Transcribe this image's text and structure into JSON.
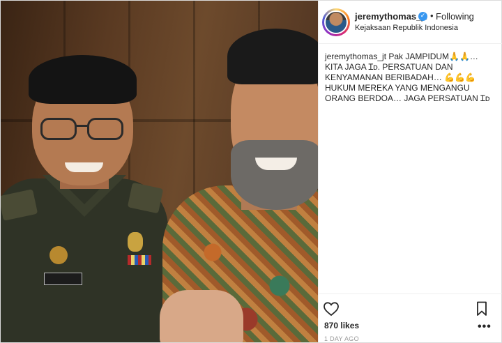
{
  "post": {
    "username": "jeremythomas_jt",
    "verified_icon": "verified-badge-icon",
    "separator": "•",
    "follow_status": "Following",
    "location": "Kejaksaan Republik Indonesia",
    "caption_user": "jeremythomas_jt",
    "caption_lines": [
      "Pak JAMPIDUM🙏🙏…",
      "KITA JAGA ɪᴅ. PERSATUAN DAN",
      "KENYAMANAN BERIBADAH… 💪💪💪",
      "HUKUM MEREKA YANG MENGANGU",
      "ORANG BERDOA… JAGA PERSATUAN ɪᴅ"
    ],
    "likes": "870 likes",
    "timestamp": "1 DAY AGO",
    "more_label": "•••"
  },
  "photo": {
    "nametag_text": "MOOR BACHMAD"
  }
}
